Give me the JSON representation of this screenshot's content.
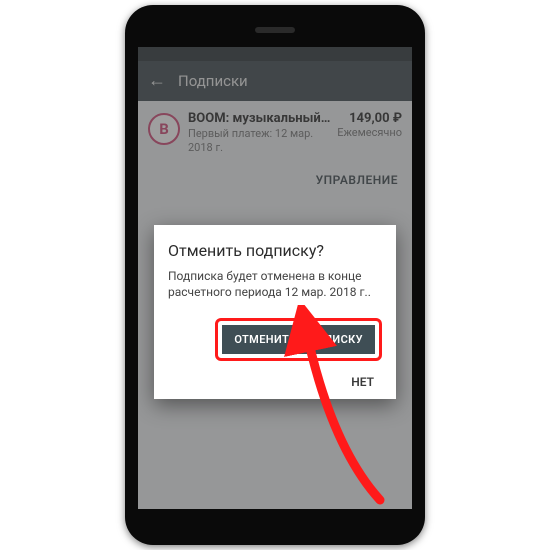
{
  "appbar": {
    "title": "Подписки"
  },
  "subscription": {
    "icon_letter": "B",
    "title": "BOOM: музыкальный…",
    "subtitle": "Первый платеж: 12 мар. 2018 г.",
    "price": "149,00 ₽",
    "period": "Ежемесячно",
    "manage": "УПРАВЛЕНИЕ"
  },
  "dialog": {
    "title": "Отменить подписку?",
    "body": "Подписка будет отменена в конце расчетного периода 12 мар. 2018 г..",
    "primary": "ОТМЕНИТЬ ПОДПИСКУ",
    "secondary": "НЕТ"
  }
}
